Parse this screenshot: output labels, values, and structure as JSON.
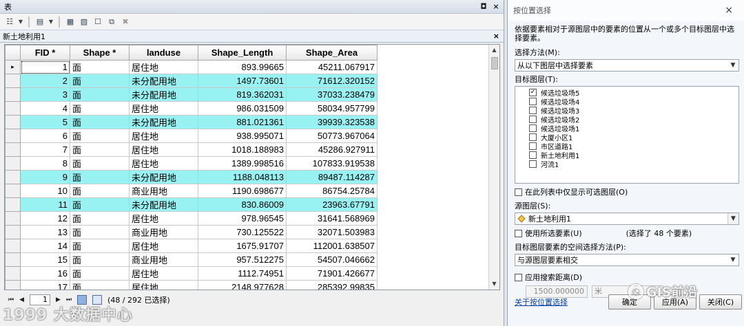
{
  "table_window": {
    "title": "表",
    "controls": {
      "restore": "◘",
      "close": "×"
    },
    "tab": {
      "label": "新土地利用1",
      "close": "×"
    },
    "columns": [
      "FID *",
      "Shape *",
      "landuse",
      "Shape_Length",
      "Shape_Area"
    ],
    "rows": [
      {
        "fid": "1",
        "shape": "面",
        "landuse": "居住地",
        "length": "893.99665",
        "area": "45211.067917",
        "highlighted": false,
        "current": true
      },
      {
        "fid": "2",
        "shape": "面",
        "landuse": "未分配用地",
        "length": "1497.73601",
        "area": "71612.320152",
        "highlighted": true
      },
      {
        "fid": "3",
        "shape": "面",
        "landuse": "未分配用地",
        "length": "819.362031",
        "area": "37033.238479",
        "highlighted": true
      },
      {
        "fid": "4",
        "shape": "面",
        "landuse": "居住地",
        "length": "986.031509",
        "area": "58034.957799",
        "highlighted": false
      },
      {
        "fid": "5",
        "shape": "面",
        "landuse": "未分配用地",
        "length": "881.021361",
        "area": "39939.323538",
        "highlighted": true
      },
      {
        "fid": "6",
        "shape": "面",
        "landuse": "居住地",
        "length": "938.995071",
        "area": "50773.967064",
        "highlighted": false
      },
      {
        "fid": "7",
        "shape": "面",
        "landuse": "居住地",
        "length": "1018.188983",
        "area": "45286.927911",
        "highlighted": false
      },
      {
        "fid": "8",
        "shape": "面",
        "landuse": "居住地",
        "length": "1389.998516",
        "area": "107833.919538",
        "highlighted": false
      },
      {
        "fid": "9",
        "shape": "面",
        "landuse": "未分配用地",
        "length": "1188.048113",
        "area": "89487.114287",
        "highlighted": true
      },
      {
        "fid": "10",
        "shape": "面",
        "landuse": "商业用地",
        "length": "1190.698677",
        "area": "86754.25784",
        "highlighted": false
      },
      {
        "fid": "11",
        "shape": "面",
        "landuse": "未分配用地",
        "length": "830.86009",
        "area": "23963.67791",
        "highlighted": true
      },
      {
        "fid": "12",
        "shape": "面",
        "landuse": "居住地",
        "length": "978.96545",
        "area": "31641.568969",
        "highlighted": false
      },
      {
        "fid": "13",
        "shape": "面",
        "landuse": "商业用地",
        "length": "730.125522",
        "area": "32071.503983",
        "highlighted": false
      },
      {
        "fid": "14",
        "shape": "面",
        "landuse": "居住地",
        "length": "1675.91707",
        "area": "112001.638507",
        "highlighted": false
      },
      {
        "fid": "15",
        "shape": "面",
        "landuse": "商业用地",
        "length": "957.512275",
        "area": "54507.046662",
        "highlighted": false
      },
      {
        "fid": "16",
        "shape": "面",
        "landuse": "居住地",
        "length": "1112.74951",
        "area": "71901.426677",
        "highlighted": false
      },
      {
        "fid": "17",
        "shape": "面",
        "landuse": "居住地",
        "length": "2148.977628",
        "area": "285392.99835",
        "highlighted": false
      }
    ],
    "nav": {
      "first": "⏮",
      "prev": "◀",
      "page": "1",
      "next": "▶",
      "last": "⏭",
      "status": "(48 / 292 已选择)"
    },
    "highlight_color": "#99f2f2",
    "watermark": "1999 大数据中心"
  },
  "dialog": {
    "title": "按位置选择",
    "close": "×",
    "description": "依据要素相对于源图层中的要素的位置从一个或多个目标图层中选择要素。",
    "method_label": "选择方法(M):",
    "method_value": "从以下图层中选择要素",
    "target_label": "目标图层(T):",
    "target_layers": [
      {
        "name": "候选垃圾场5",
        "checked": true
      },
      {
        "name": "候选垃圾场4",
        "checked": false
      },
      {
        "name": "候选垃圾场3",
        "checked": false
      },
      {
        "name": "候选垃圾场2",
        "checked": false
      },
      {
        "name": "候选垃圾场1",
        "checked": false
      },
      {
        "name": "大厦小区1",
        "checked": false
      },
      {
        "name": "市区道路1",
        "checked": false
      },
      {
        "name": "新土地利用1",
        "checked": false
      },
      {
        "name": "河流1",
        "checked": false
      }
    ],
    "only_selectable_label": "在此列表中仅显示可选图层(O)",
    "source_label": "源图层(S):",
    "source_value": "新土地利用1",
    "use_selected_label": "使用所选要素(U)",
    "selected_count": "(选择了 48 个要素)",
    "spatial_label": "目标图层要素的空间选择方法(P):",
    "spatial_value": "与源图层要素相交",
    "search_distance_label": "应用搜索距离(D)",
    "search_distance_value": "1500.000000",
    "search_unit": "米",
    "help_link": "关于按位置选择",
    "ok": "确定",
    "apply": "应用(A)",
    "close_btn": "关闭(C)",
    "watermark": "GIS前沿"
  }
}
